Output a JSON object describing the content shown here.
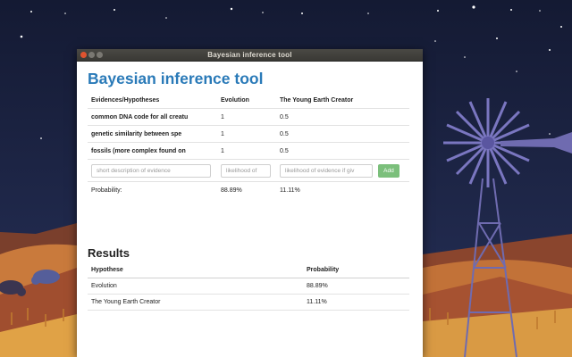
{
  "window": {
    "title": "Bayesian inference tool"
  },
  "app": {
    "heading": "Bayesian inference tool"
  },
  "evidence_table": {
    "headers": [
      "Evidences/Hypotheses",
      "Evolution",
      "The Young Earth Creator"
    ],
    "rows": [
      {
        "evidence": "common DNA code for all creatu",
        "evolution": "1",
        "creator": "0.5"
      },
      {
        "evidence": "genetic similarity between spe",
        "evolution": "1",
        "creator": "0.5"
      },
      {
        "evidence": "fossils (more complex found on",
        "evolution": "1",
        "creator": "0.5"
      }
    ],
    "inputs": {
      "description_placeholder": "short description of evidence",
      "likelihood_placeholder": "likelihood of",
      "likelihood_if_placeholder": "likelihood of evidence if giv",
      "add_label": "Add"
    },
    "probability_row": {
      "label": "Probability:",
      "evolution": "88.89%",
      "creator": "11.11%"
    }
  },
  "results": {
    "heading": "Results",
    "headers": [
      "Hypothese",
      "Probability"
    ],
    "rows": [
      {
        "hypothesis": "Evolution",
        "probability": "88.89%"
      },
      {
        "hypothesis": "The Young Earth Creator",
        "probability": "11.11%"
      }
    ]
  },
  "colors": {
    "accent": "#2a7ab8",
    "add_button": "#7bbf7b",
    "close_button": "#e0532f"
  }
}
